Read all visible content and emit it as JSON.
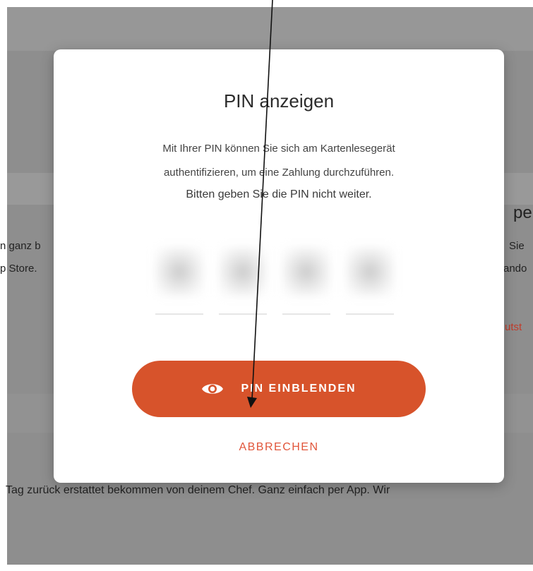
{
  "background": {
    "left_fragment_1": "n ganz b",
    "left_fragment_2": "p Store.",
    "right_fragment_1": "pen",
    "right_fragment_2": "Sie",
    "right_fragment_3": "ando",
    "right_link_fragment": "utst",
    "bottom_sentence": "Tag zurück erstattet bekommen von deinem Chef. Ganz einfach per App. Wir"
  },
  "modal": {
    "title": "PIN anzeigen",
    "description_line1": "Mit Ihrer PIN können Sie sich am Kartenlesegerät",
    "description_line2": "authentifizieren, um eine Zahlung durchzuführen.",
    "warning": "Bitten geben Sie die PIN nicht weiter.",
    "pin_digits_hidden": 4,
    "show_button_label": "PIN EINBLENDEN",
    "show_button_icon": "eye-icon",
    "cancel_label": "ABBRECHEN"
  },
  "colors": {
    "accent": "#d7532b",
    "cancel_text": "#e1553a",
    "overlay": "#8e8e8e"
  }
}
